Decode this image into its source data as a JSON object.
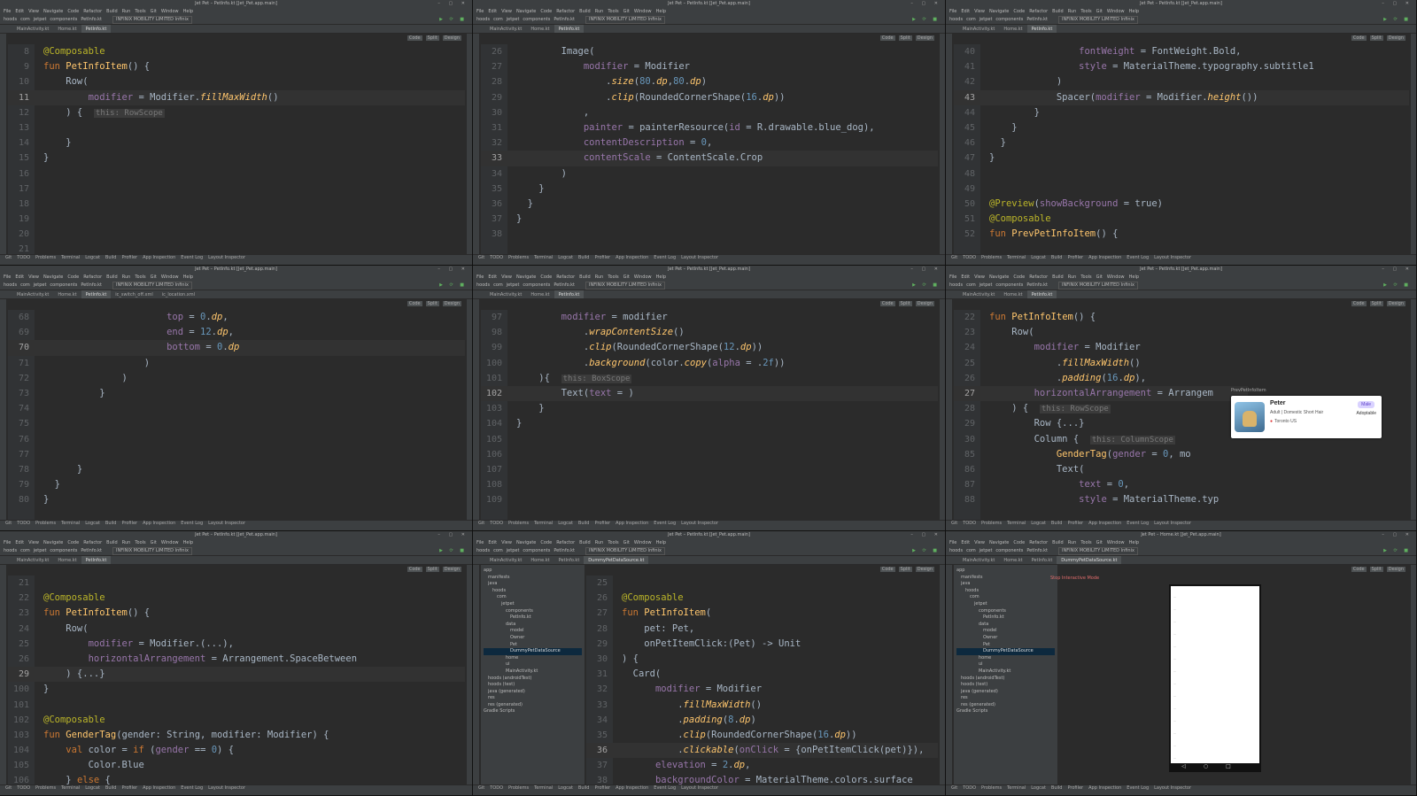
{
  "ide": {
    "window_title_main": "Jet Pet – PetInfo.kt [Jet_Pet.app.main]",
    "window_title_home": "Jet Pet – Home.kt [Jet_Pet.app.main]",
    "menu": [
      "File",
      "Edit",
      "View",
      "Navigate",
      "Code",
      "Refactor",
      "Build",
      "Run",
      "Tools",
      "Git",
      "Window",
      "Help"
    ],
    "breadcrumb": [
      "hoods",
      "com",
      "jetpet",
      "components",
      "PetInfo.kt"
    ],
    "device": "INFINIX MOBILITY LIMITED Infinix",
    "view_modes": [
      "Code",
      "Split",
      "Design"
    ],
    "tabs_default": [
      "MainActivity.kt",
      "Home.kt",
      "PetInfo.kt"
    ],
    "tabs_extra": [
      "ic_switch_off.xml",
      "ic_location.xml"
    ],
    "tab_dummy": "DummyPetDataSource.kt",
    "bottom_tools": [
      "Git",
      "TODO",
      "Problems",
      "Terminal",
      "Logcat",
      "Build",
      "Profiler",
      "App Inspection",
      "Event Log",
      "Layout Inspector"
    ],
    "preview_label": "PrevPetInfoItem",
    "interactive_label": "Stop Interactive Mode"
  },
  "panes": [
    {
      "cur": 11,
      "lines": [
        {
          "n": 8,
          "t": "@Composable"
        },
        {
          "n": 9,
          "t": "fun PetInfoItem() {"
        },
        {
          "n": 10,
          "t": "    Row("
        },
        {
          "n": 11,
          "t": "        modifier = Modifier.fillMaxWidth()"
        },
        {
          "n": 12,
          "t": "    ) {",
          "hint": "this: RowScope"
        },
        {
          "n": 13,
          "t": ""
        },
        {
          "n": 14,
          "t": "    }"
        },
        {
          "n": 15,
          "t": "}"
        },
        {
          "n": 16,
          "t": ""
        },
        {
          "n": 17,
          "t": ""
        },
        {
          "n": 18,
          "t": ""
        },
        {
          "n": 19,
          "t": ""
        },
        {
          "n": 20,
          "t": ""
        },
        {
          "n": 21,
          "t": ""
        }
      ]
    },
    {
      "cur": 33,
      "lines": [
        {
          "n": 26,
          "t": "        Image("
        },
        {
          "n": 27,
          "t": "            modifier = Modifier"
        },
        {
          "n": 28,
          "t": "                .size(80.dp,80.dp)"
        },
        {
          "n": 29,
          "t": "                .clip(RoundedCornerShape(16.dp))"
        },
        {
          "n": 30,
          "t": "            ,"
        },
        {
          "n": 31,
          "t": "            painter = painterResource(id = R.drawable.blue_dog),"
        },
        {
          "n": 32,
          "t": "            contentDescription = \"\","
        },
        {
          "n": 33,
          "t": "            contentScale = ContentScale.Crop"
        },
        {
          "n": 34,
          "t": "        )"
        },
        {
          "n": 35,
          "t": "    }"
        },
        {
          "n": 36,
          "t": "  }"
        },
        {
          "n": 37,
          "t": "}"
        },
        {
          "n": 38,
          "t": ""
        }
      ]
    },
    {
      "cur": 43,
      "lines": [
        {
          "n": 40,
          "t": "                fontWeight = FontWeight.Bold,"
        },
        {
          "n": 41,
          "t": "                style = MaterialTheme.typography.subtitle1"
        },
        {
          "n": 42,
          "t": "            )"
        },
        {
          "n": 43,
          "t": "            Spacer(modifier = Modifier.height())"
        },
        {
          "n": 44,
          "t": "        }"
        },
        {
          "n": 45,
          "t": "    }"
        },
        {
          "n": 46,
          "t": "  }"
        },
        {
          "n": 47,
          "t": "}"
        },
        {
          "n": 48,
          "t": ""
        },
        {
          "n": 49,
          "t": ""
        },
        {
          "n": 50,
          "t": "@Preview(showBackground = true)"
        },
        {
          "n": 51,
          "t": "@Composable"
        },
        {
          "n": 52,
          "t": "fun PrevPetInfoItem() {"
        }
      ]
    },
    {
      "cur": 70,
      "lines": [
        {
          "n": 68,
          "t": "                      top = 0.dp,"
        },
        {
          "n": 69,
          "t": "                      end = 12.dp,"
        },
        {
          "n": 70,
          "t": "                      bottom = 0.dp"
        },
        {
          "n": 71,
          "t": "                  )"
        },
        {
          "n": 72,
          "t": "              )"
        },
        {
          "n": 73,
          "t": "          }"
        },
        {
          "n": 74,
          "t": ""
        },
        {
          "n": 75,
          "t": ""
        },
        {
          "n": 76,
          "t": ""
        },
        {
          "n": 77,
          "t": ""
        },
        {
          "n": 78,
          "t": "      }"
        },
        {
          "n": 79,
          "t": "  }"
        },
        {
          "n": 80,
          "t": "}"
        }
      ]
    },
    {
      "cur": 102,
      "lines": [
        {
          "n": 97,
          "t": "        modifier = modifier"
        },
        {
          "n": 98,
          "t": "            .wrapContentSize()"
        },
        {
          "n": 99,
          "t": "            .clip(RoundedCornerShape(12.dp))"
        },
        {
          "n": 100,
          "t": "            .background(color.copy(alpha = .2f))"
        },
        {
          "n": 101,
          "t": "    ){",
          "hint": "this: BoxScope"
        },
        {
          "n": 102,
          "t": "        Text(text = )"
        },
        {
          "n": 103,
          "t": "    }"
        },
        {
          "n": 104,
          "t": "}"
        },
        {
          "n": 105,
          "t": ""
        },
        {
          "n": 106,
          "t": ""
        },
        {
          "n": 107,
          "t": ""
        },
        {
          "n": 108,
          "t": ""
        },
        {
          "n": 109,
          "t": ""
        }
      ]
    },
    {
      "cur": 27,
      "lines": [
        {
          "n": 22,
          "t": "fun PetInfoItem() {"
        },
        {
          "n": 23,
          "t": "    Row("
        },
        {
          "n": 24,
          "t": "        modifier = Modifier"
        },
        {
          "n": 25,
          "t": "            .fillMaxWidth()"
        },
        {
          "n": 26,
          "t": "            .padding(16.dp),"
        },
        {
          "n": 27,
          "t": "        horizontalArrangement = Arrangem"
        },
        {
          "n": 28,
          "t": "    ) {",
          "hint": "this: RowScope"
        },
        {
          "n": 29,
          "t": "        Row {...}"
        },
        {
          "n": 30,
          "t": "        Column {",
          "hint": "this: ColumnScope"
        },
        {
          "n": 85,
          "t": "            GenderTag(gender = \"Male\", mo"
        },
        {
          "n": 86,
          "t": "            Text("
        },
        {
          "n": 87,
          "t": "                text = \"Adoptable\","
        },
        {
          "n": 88,
          "t": "                style = MaterialTheme.typ"
        }
      ]
    },
    {
      "cur": 29,
      "lines": [
        {
          "n": 21,
          "t": ""
        },
        {
          "n": 22,
          "t": "@Composable"
        },
        {
          "n": 23,
          "t": "fun PetInfoItem() {"
        },
        {
          "n": 24,
          "t": "    Row("
        },
        {
          "n": 25,
          "t": "        modifier = Modifier.(...),"
        },
        {
          "n": 26,
          "t": "        horizontalArrangement = Arrangement.SpaceBetween"
        },
        {
          "n": 29,
          "t": "    ) {...}"
        },
        {
          "n": 100,
          "t": "}"
        },
        {
          "n": 101,
          "t": ""
        },
        {
          "n": 102,
          "t": "@Composable"
        },
        {
          "n": 103,
          "t": "fun GenderTag(gender: String, modifier: Modifier) {"
        },
        {
          "n": 104,
          "t": "    val color = if (gender == \"Male\") {"
        },
        {
          "n": 105,
          "t": "        Color.Blue"
        },
        {
          "n": 106,
          "t": "    } else {"
        },
        {
          "n": 107,
          "t": "        Color.Red"
        }
      ]
    },
    {
      "cur": 36,
      "tree": [
        "app",
        "manifests",
        "java",
        "hoods",
        "com",
        "jetpet",
        "components",
        "PetInfo.kt",
        "data",
        "model",
        "Owner",
        "Pet",
        "DummyPetDataSource",
        "home",
        "ui",
        "MainActivity.kt",
        "hoods (androidTest)",
        "hoods (test)",
        "java (generated)",
        "res",
        "res (generated)",
        "Gradle Scripts"
      ],
      "lines": [
        {
          "n": 25,
          "t": ""
        },
        {
          "n": 26,
          "t": "@Composable"
        },
        {
          "n": 27,
          "t": "fun PetInfoItem("
        },
        {
          "n": 28,
          "t": "    pet: Pet,"
        },
        {
          "n": 29,
          "t": "    onPetItemClick:(Pet) -> Unit"
        },
        {
          "n": 30,
          "t": ") {"
        },
        {
          "n": 31,
          "t": "  Card("
        },
        {
          "n": 32,
          "t": "      modifier = Modifier"
        },
        {
          "n": 33,
          "t": "          .fillMaxWidth()"
        },
        {
          "n": 34,
          "t": "          .padding(8.dp)"
        },
        {
          "n": 35,
          "t": "          .clip(RoundedCornerShape(16.dp))"
        },
        {
          "n": 36,
          "t": "          .clickable(onClick = {onPetItemClick(pet)}),"
        },
        {
          "n": 37,
          "t": "      elevation = 2.dp,"
        },
        {
          "n": 38,
          "t": "      backgroundColor = MaterialTheme.colors.surface"
        },
        {
          "n": 39,
          "t": "  ) {"
        }
      ]
    },
    {
      "tree": [
        "app",
        "manifests",
        "java",
        "hoods",
        "com",
        "jetpet",
        "components",
        "PetInfo.kt",
        "data",
        "model",
        "Owner",
        "Pet",
        "DummyPetDataSource",
        "home",
        "ui",
        "MainActivity.kt",
        "hoods (androidTest)",
        "hoods (test)",
        "java (generated)",
        "res",
        "res (generated)",
        "Gradle Scripts"
      ]
    }
  ],
  "preview": {
    "name": "Peter",
    "desc": "Adult | Domestic Short Hair",
    "location": "Toronto US",
    "tag": "Male",
    "status": "Adoptable"
  }
}
